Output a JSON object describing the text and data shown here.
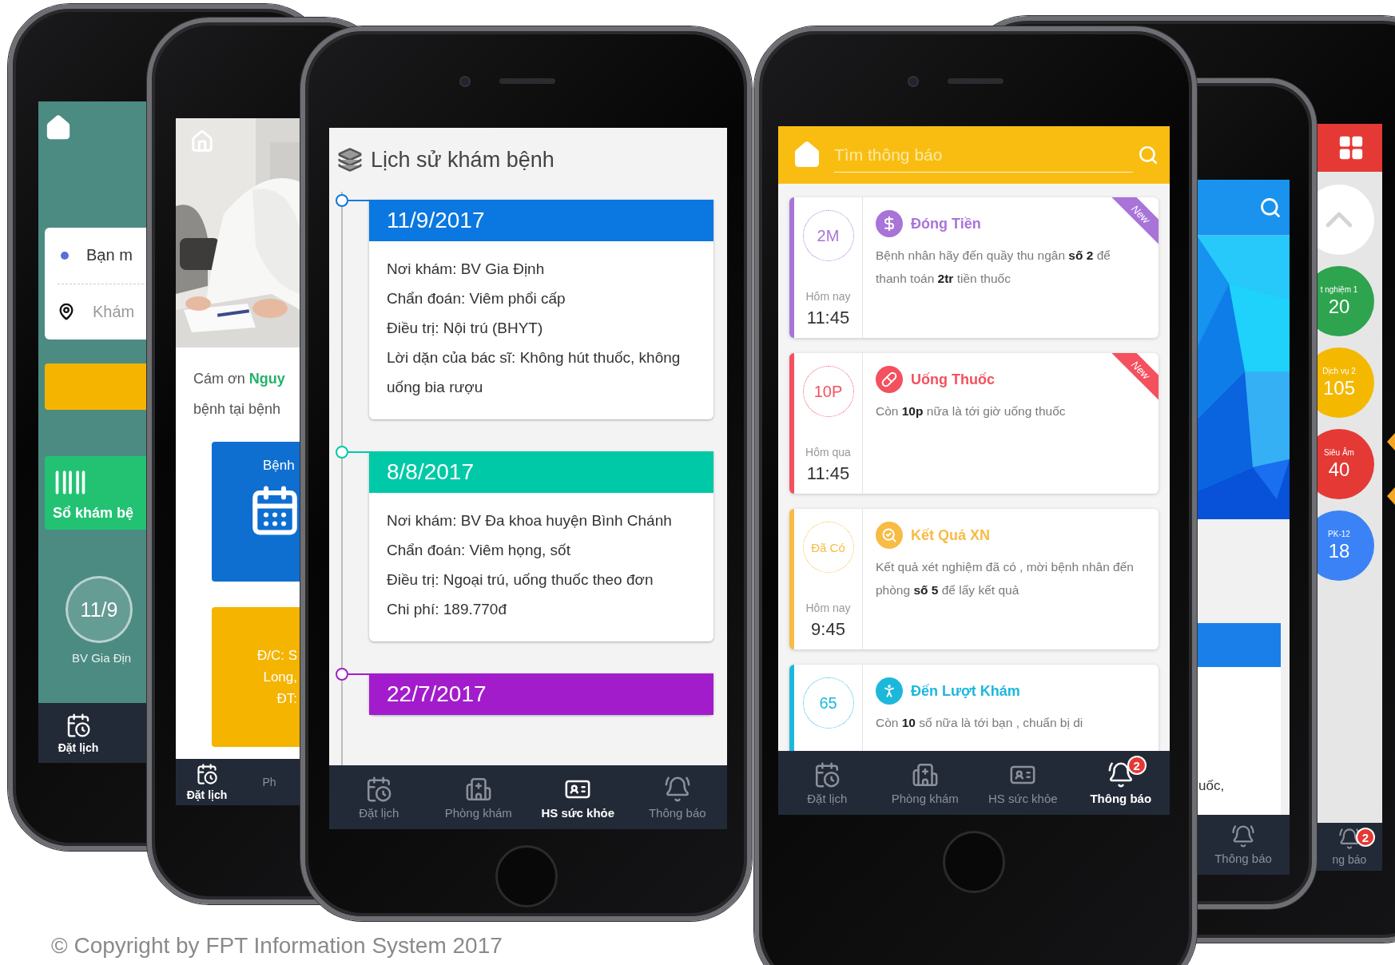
{
  "booking_screen": {
    "search_card": {
      "origin": "Bạn m",
      "destination": "Khám"
    },
    "health_book_tile": "Sổ khám bệ",
    "appointment": {
      "date": "11/9",
      "hospital": "BV Gia Địn"
    },
    "nav": [
      {
        "label": "Đặt lịch",
        "kind": "calendar",
        "selected": true
      }
    ]
  },
  "welcome_screen": {
    "greeting": [
      "Cám ơn **Nguy**",
      "bệnh tại bệnh"
    ],
    "hospital_tile": "Bệnh",
    "address_tile": [
      "Đ/C: S",
      "Long,",
      "ĐT:"
    ],
    "nav": [
      {
        "label": "Đặt lịch",
        "kind": "calendar",
        "selected": true
      },
      {
        "label": "Ph",
        "kind": "text",
        "selected": false
      }
    ]
  },
  "history_screen": {
    "title": "Lịch sử khám bệnh",
    "records": [
      {
        "date": "11/9/2017",
        "color": "#0a78e0",
        "lines": [
          "Nơi khám: BV Gia Định",
          "Chẩn đoán: Viêm phổi cấp",
          "Điều trị: Nội trú (BHYT)",
          "Lời dặn của bác sĩ: Không hút thuốc, không uống bia rượu"
        ]
      },
      {
        "date": "8/8/2017",
        "color": "#00c9a7",
        "lines": [
          "Nơi khám: BV Đa khoa huyện Bình Chánh",
          "Chẩn đoán: Viêm họng, sốt",
          "Điều trị: Ngoại trú, uống thuốc theo đơn",
          "Chi phí: 189.770đ"
        ]
      },
      {
        "date": "22/7/2017",
        "color": "#a31ccc"
      }
    ],
    "nav": [
      {
        "label": "Đặt lịch",
        "kind": "calendar",
        "selected": false
      },
      {
        "label": "Phòng khám",
        "kind": "clinic",
        "selected": false
      },
      {
        "label": "HS sức khỏe",
        "kind": "record",
        "selected": true
      },
      {
        "label": "Thông báo",
        "kind": "bell",
        "selected": false
      }
    ]
  },
  "notifications_screen": {
    "search": {
      "placeholder": "Tìm thông báo"
    },
    "notifications": [
      {
        "kind": "payment",
        "color": "#a874d8",
        "badge": "2M",
        "day": "Hôm nay",
        "time": "11:45",
        "title": "Đóng Tiền",
        "body": "Bệnh nhân hãy đến quầy thu ngân **số 2** để thanh toán **2tr** tiền thuốc",
        "ribbon": "New"
      },
      {
        "kind": "medicine",
        "color": "#f4505e",
        "badge": "10P",
        "day": "Hôm qua",
        "time": "11:45",
        "title": "Uống Thuốc",
        "body": "Còn **10p** nữa là tới giờ uống thuốc",
        "ribbon": "New"
      },
      {
        "kind": "result",
        "color": "#f8bb44",
        "badge": "Đã Có",
        "day": "Hôm nay",
        "time": "9:45",
        "title": "Kết Quả XN",
        "body": "Kết quả xét nghiệm đã có , mời bệnh nhân đến phòng **số 5** để lấy kết quả"
      },
      {
        "kind": "queue",
        "color": "#1cb8dc",
        "badge": "65",
        "title": "Đến Lượt Khám",
        "body": "Còn **10** số nữa là tới bạn , chuẩn bị di"
      }
    ],
    "nav": [
      {
        "label": "Đặt lịch",
        "kind": "calendar",
        "selected": false
      },
      {
        "label": "Phòng khám",
        "kind": "clinic",
        "selected": false
      },
      {
        "label": "HS sức khỏe",
        "kind": "record",
        "selected": false
      },
      {
        "label": "Thông báo",
        "kind": "bell",
        "selected": true,
        "badge": "2"
      }
    ]
  },
  "home_screen": {
    "snippet": "uốc,",
    "nav": [
      {
        "label": "Thông báo",
        "kind": "bell",
        "selected": false
      }
    ]
  },
  "queue_screen": {
    "queues": [
      {
        "label": "t nghiệm 1",
        "count": "20",
        "color": "#2ea44f"
      },
      {
        "label": "Dịch vụ 2",
        "count": "105",
        "color": "#f5b800"
      },
      {
        "label": "Siêu Âm",
        "count": "40",
        "color": "#e53935"
      },
      {
        "label": "PK-12",
        "count": "18",
        "color": "#3b82f6"
      }
    ],
    "nav": [
      {
        "label": "ng báo",
        "kind": "bell",
        "selected": false,
        "badge": "2"
      }
    ]
  },
  "copyright": "© Copyright by FPT Information System 2017"
}
